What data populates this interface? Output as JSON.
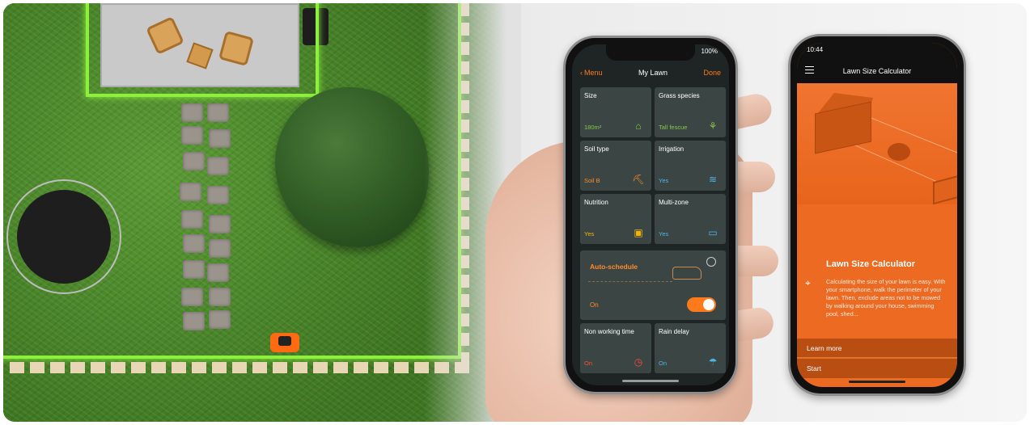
{
  "colors": {
    "accent": "#ff7a1a",
    "wire": "#8cf03c",
    "tile": "#3b4644",
    "calc_bg": "#ec6a22"
  },
  "phone1": {
    "status_right": "100%",
    "nav": {
      "back_label": "Menu",
      "title": "My Lawn",
      "done_label": "Done"
    },
    "tiles": [
      {
        "label": "Size",
        "value": "180m²",
        "value_color": "#86c54a",
        "icon": "lawn-size-icon"
      },
      {
        "label": "Grass species",
        "value": "Tall fescue",
        "value_color": "#86c54a",
        "icon": "grass-icon"
      },
      {
        "label": "Soil type",
        "value": "Soil B",
        "value_color": "#ff8a2b",
        "icon": "soil-icon"
      },
      {
        "label": "Irrigation",
        "value": "Yes",
        "value_color": "#4fb4e8",
        "icon": "sprinkler-icon"
      },
      {
        "label": "Nutrition",
        "value": "Yes",
        "value_color": "#f2b705",
        "icon": "fertilizer-icon"
      },
      {
        "label": "Multi-zone",
        "value": "Yes",
        "value_color": "#4fb4e8",
        "icon": "zones-icon"
      }
    ],
    "auto_schedule": {
      "label": "Auto-schedule",
      "state": "On"
    },
    "bottom_tiles": [
      {
        "label": "Non working time",
        "value": "On",
        "value_color": "#ff4a3a",
        "icon": "clock-icon"
      },
      {
        "label": "Rain delay",
        "value": "On",
        "value_color": "#4fb4e8",
        "icon": "rain-icon"
      }
    ]
  },
  "phone2": {
    "status_time": "10:44",
    "header_title": "Lawn Size Calculator",
    "card_title": "Lawn Size Calculator",
    "body": "Calculating the size of your lawn is easy. With your smartphone, walk the perimeter of your lawn. Then, exclude areas not to be mowed by walking around your house, swimming pool, shed...",
    "learn_more": "Learn more",
    "start": "Start"
  }
}
